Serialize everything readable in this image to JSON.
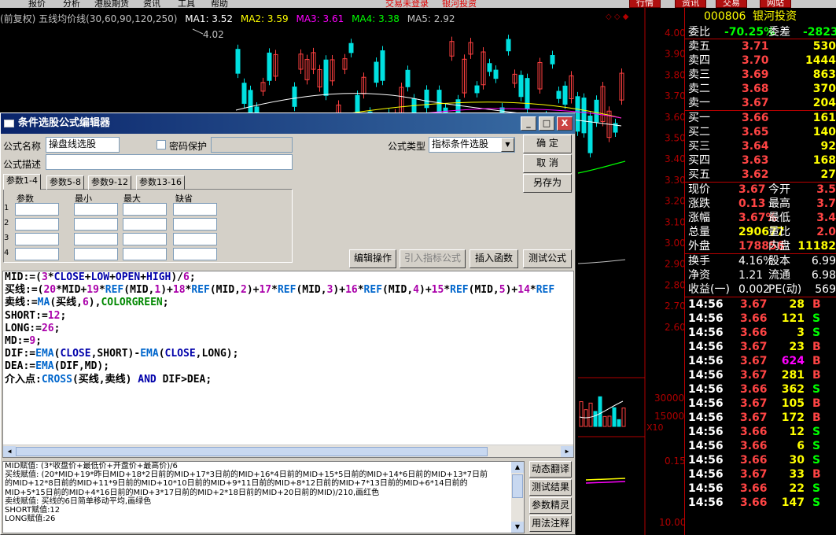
{
  "menubar": {
    "items": [
      "报价",
      "分析",
      "港股期货",
      "资讯",
      "工具",
      "帮助"
    ],
    "status": "交易未登录",
    "broker": "银河投资",
    "right_buttons": [
      "行情",
      "资讯",
      "交易",
      "网站"
    ]
  },
  "chart": {
    "title": "(前复权) 五线均价线(30,60,90,120,250)",
    "ma": [
      {
        "label": "MA1: 3.52",
        "color": "#ffffff"
      },
      {
        "label": "MA2: 3.59",
        "color": "#ffff00"
      },
      {
        "label": "MA3: 3.61",
        "color": "#ff00ff"
      },
      {
        "label": "MA4: 3.38",
        "color": "#00ff00"
      },
      {
        "label": "MA5: 2.92",
        "color": "#c0c0c0"
      }
    ],
    "high_mark": "4.02",
    "price_axis": [
      "4.00",
      "3.90",
      "3.80",
      "3.70",
      "3.60",
      "3.50",
      "3.40",
      "3.30",
      "3.20",
      "3.10",
      "3.00",
      "2.90",
      "2.80",
      "2.70",
      "2.60"
    ],
    "vol_axis": [
      "30000",
      "15000",
      "X10"
    ],
    "ind_axis": [
      "0.15",
      "10.00"
    ]
  },
  "stock": {
    "code": "000806",
    "name": "银河投资"
  },
  "quote": {
    "wb_label": "委比",
    "wb": "-70.25%",
    "wc_label": "委差",
    "wc": "-2823",
    "sell": [
      {
        "label": "卖五",
        "price": "3.71",
        "vol": "530"
      },
      {
        "label": "卖四",
        "price": "3.70",
        "vol": "1444"
      },
      {
        "label": "卖三",
        "price": "3.69",
        "vol": "863"
      },
      {
        "label": "卖二",
        "price": "3.68",
        "vol": "370"
      },
      {
        "label": "卖一",
        "price": "3.67",
        "vol": "204"
      }
    ],
    "buy": [
      {
        "label": "买一",
        "price": "3.66",
        "vol": "161"
      },
      {
        "label": "买二",
        "price": "3.65",
        "vol": "140"
      },
      {
        "label": "买三",
        "price": "3.64",
        "vol": "92"
      },
      {
        "label": "买四",
        "price": "3.63",
        "vol": "168"
      },
      {
        "label": "买五",
        "price": "3.62",
        "vol": "27"
      }
    ],
    "stats": [
      {
        "l1": "现价",
        "v1": "3.67",
        "l2": "今开",
        "v2": "3.5"
      },
      {
        "l1": "涨跌",
        "v1": "0.13",
        "l2": "最高",
        "v2": "3.7"
      },
      {
        "l1": "涨幅",
        "v1": "3.67%",
        "l2": "最低",
        "v2": "3.4"
      },
      {
        "l1": "总量",
        "v1": "290677",
        "l2": "量比",
        "v2": "2.0"
      },
      {
        "l1": "外盘",
        "v1": "178856",
        "l2": "内盘",
        "v2": "11182"
      }
    ],
    "stats2": [
      {
        "l1": "换手",
        "v1": "4.16%",
        "l2": "股本",
        "v2": "6.99"
      },
      {
        "l1": "净资",
        "v1": "1.21",
        "l2": "流通",
        "v2": "6.98"
      },
      {
        "l1": "收益(一)",
        "v1": "0.002",
        "l2": "PE(动)",
        "v2": "569"
      }
    ],
    "ticks": [
      {
        "t": "14:56",
        "p": "3.67",
        "v": "28",
        "s": "B"
      },
      {
        "t": "14:56",
        "p": "3.66",
        "v": "121",
        "s": "S"
      },
      {
        "t": "14:56",
        "p": "3.66",
        "v": "3",
        "s": "S"
      },
      {
        "t": "14:56",
        "p": "3.67",
        "v": "23",
        "s": "B"
      },
      {
        "t": "14:56",
        "p": "3.67",
        "v": "624",
        "s": "B"
      },
      {
        "t": "14:56",
        "p": "3.67",
        "v": "281",
        "s": "B"
      },
      {
        "t": "14:56",
        "p": "3.66",
        "v": "362",
        "s": "S"
      },
      {
        "t": "14:56",
        "p": "3.67",
        "v": "105",
        "s": "B"
      },
      {
        "t": "14:56",
        "p": "3.67",
        "v": "172",
        "s": "B"
      },
      {
        "t": "14:56",
        "p": "3.66",
        "v": "12",
        "s": "S"
      },
      {
        "t": "14:56",
        "p": "3.66",
        "v": "6",
        "s": "S"
      },
      {
        "t": "14:56",
        "p": "3.66",
        "v": "30",
        "s": "S"
      },
      {
        "t": "14:56",
        "p": "3.67",
        "v": "33",
        "s": "B"
      },
      {
        "t": "14:56",
        "p": "3.66",
        "v": "22",
        "s": "S"
      },
      {
        "t": "14:56",
        "p": "3.66",
        "v": "147",
        "s": "S"
      }
    ]
  },
  "dialog": {
    "title": "条件选股公式编辑器",
    "min": "_",
    "max": "□",
    "close": "X",
    "name_label": "公式名称",
    "name_value": "操盘线选股",
    "pwd_label": "密码保护",
    "type_label": "公式类型",
    "type_value": "指标条件选股",
    "desc_label": "公式描述",
    "ok": "确  定",
    "cancel": "取  消",
    "saveas": "另存为",
    "tabs": [
      "参数1-4",
      "参数5-8",
      "参数9-12",
      "参数13-16"
    ],
    "param_headers": [
      "参数",
      "最小",
      "最大",
      "缺省"
    ],
    "param_rows": [
      "1",
      "2",
      "3",
      "4"
    ],
    "btn_edit": "编辑操作",
    "btn_import": "引入指标公式",
    "btn_insert": "插入函数",
    "btn_test": "测试公式",
    "side_btns": [
      "动态翻译",
      "测试结果",
      "参数精灵",
      "用法注释"
    ]
  },
  "code": [
    "MID:=(3*CLOSE+LOW+OPEN+HIGH)/6;",
    "买线:=(20*MID+19*REF(MID,1)+18*REF(MID,2)+17*REF(MID,3)+16*REF(MID,4)+15*REF(MID,5)+14*REF",
    "卖线:=MA(买线,6),COLORGREEN;",
    "SHORT:=12;",
    "LONG:=26;",
    "MD:=9;",
    "DIF:=EMA(CLOSE,SHORT)-EMA(CLOSE,LONG);",
    "DEA:=EMA(DIF,MD);",
    "介入点:CROSS(买线,卖线) AND DIF>DEA;"
  ],
  "explain": [
    "MID赋值: (3*收盘价+最低价+开盘价+最高价)/6",
    "买线赋值: (20*MID+19*昨日MID+18*2日前的MID+17*3日前的MID+16*4日前的MID+15*5日前的MID+14*6日前的MID+13*7日前",
    "的MID+12*8日前的MID+11*9日前的MID+10*10日前的MID+9*11日前的MID+8*12日前的MID+7*13日前的MID+6*14日前的",
    "MID+5*15日前的MID+4*16日前的MID+3*17日前的MID+2*18日前的MID+20日前的MID)/210,画红色",
    "卖线赋值: 买线的6日简单移动平均,画绿色",
    "SHORT赋值:12",
    "LONG赋值:26"
  ]
}
